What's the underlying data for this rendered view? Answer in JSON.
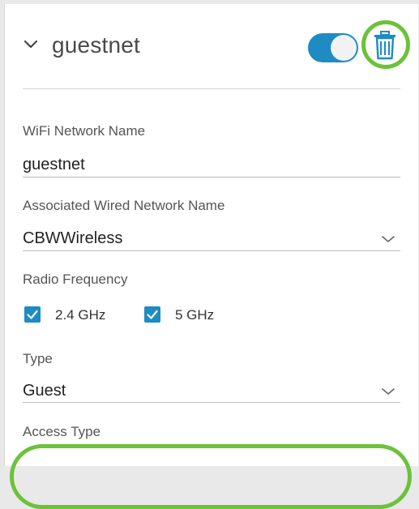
{
  "network": {
    "title": "guestnet",
    "enabled": true
  },
  "fields": {
    "ssid_label": "WiFi Network Name",
    "ssid_value": "guestnet",
    "wired_label": "Associated Wired Network Name",
    "wired_value": "CBWWireless",
    "radio_label": "Radio Frequency",
    "radio_options": [
      {
        "label": "2.4 GHz",
        "checked": true
      },
      {
        "label": "5 GHz",
        "checked": true
      }
    ],
    "type_label": "Type",
    "type_value": "Guest",
    "access_label": "Access Type"
  },
  "colors": {
    "accent": "#1e8bc3",
    "highlight": "#6cc23a"
  },
  "icons": {
    "expand": "chevron-down-icon",
    "delete": "trash-icon",
    "dropdown": "chevron-down-icon",
    "check": "checkmark-icon"
  }
}
